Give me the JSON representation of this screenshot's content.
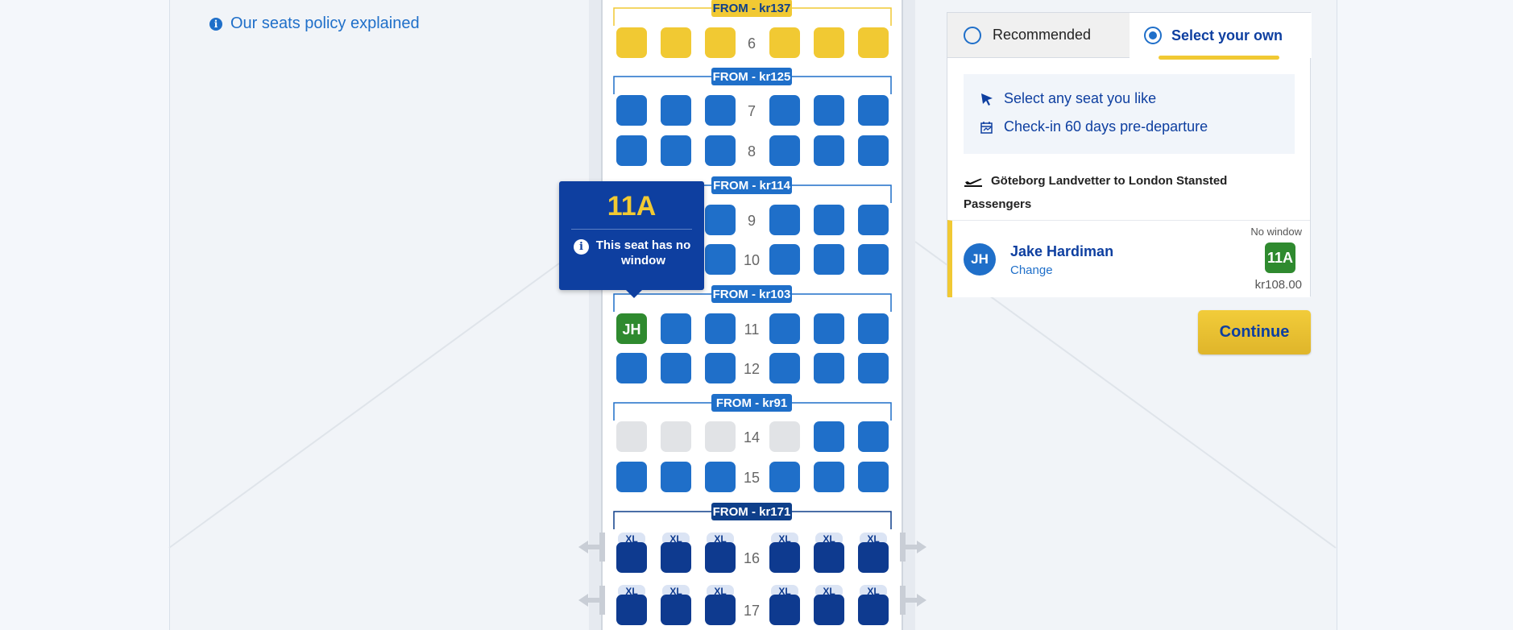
{
  "policy_link": {
    "icon": "info-icon",
    "label": "Our seats policy explained"
  },
  "seat_map": {
    "price_bands": [
      {
        "label": "FROM - kr137",
        "color": "#f1c933",
        "text_color": "#0e3f8a"
      },
      {
        "label": "FROM - kr125",
        "color": "#1f6fc9",
        "text_color": "#ffffff"
      },
      {
        "label": "FROM - kr114",
        "color": "#1f6fc9",
        "text_color": "#ffffff"
      },
      {
        "label": "FROM - kr103",
        "color": "#1f6fc9",
        "text_color": "#ffffff"
      },
      {
        "label": "FROM - kr91",
        "color": "#1f6fc9",
        "text_color": "#ffffff"
      },
      {
        "label": "FROM - kr171",
        "color": "#0e3f8a",
        "text_color": "#ffffff"
      }
    ],
    "rows": [
      {
        "number": "6",
        "type": "yellow",
        "seats": [
          "available",
          "available",
          "available",
          "available",
          "available",
          "available"
        ]
      },
      {
        "number": "7",
        "type": "blue",
        "seats": [
          "available",
          "available",
          "available",
          "available",
          "available",
          "available"
        ]
      },
      {
        "number": "8",
        "type": "blue",
        "seats": [
          "available",
          "available",
          "available",
          "available",
          "available",
          "available"
        ]
      },
      {
        "number": "9",
        "type": "blue",
        "seats": [
          "hidden",
          "hidden",
          "available",
          "available",
          "available",
          "available"
        ]
      },
      {
        "number": "10",
        "type": "blue",
        "seats": [
          "hidden",
          "hidden",
          "available",
          "available",
          "available",
          "available"
        ]
      },
      {
        "number": "11",
        "type": "blue",
        "seats": [
          "selected",
          "available",
          "available",
          "available",
          "available",
          "available"
        ]
      },
      {
        "number": "12",
        "type": "blue",
        "seats": [
          "available",
          "available",
          "available",
          "available",
          "available",
          "available"
        ]
      },
      {
        "number": "14",
        "type": "blue",
        "seats": [
          "unavailable",
          "unavailable",
          "unavailable",
          "unavailable",
          "available",
          "available"
        ]
      },
      {
        "number": "15",
        "type": "blue",
        "seats": [
          "available",
          "available",
          "available",
          "available",
          "available",
          "available"
        ]
      },
      {
        "number": "16",
        "type": "xl",
        "seats": [
          "available",
          "available",
          "available",
          "available",
          "available",
          "available"
        ]
      },
      {
        "number": "17",
        "type": "xl",
        "seats": [
          "available",
          "available",
          "available",
          "available",
          "available",
          "available"
        ]
      }
    ],
    "selected_seat_initials": "JH",
    "xl_label": "XL",
    "colors": {
      "yellow": "#f1c933",
      "blue": "#1f6fc9",
      "navy": "#0e3a8f",
      "unavailable": "#e1e3e6",
      "selected": "#2f8a2f"
    }
  },
  "tooltip": {
    "seat": "11A",
    "icon": "info-icon",
    "message": "This seat has no window"
  },
  "panel": {
    "tabs": [
      {
        "label": "Recommended",
        "selected": false
      },
      {
        "label": "Select your own",
        "selected": true
      }
    ],
    "benefits": [
      {
        "icon": "cursor-icon",
        "text": "Select any seat you like"
      },
      {
        "icon": "calendar-icon",
        "text": "Check-in 60 days pre-departure"
      }
    ],
    "route": {
      "icon": "plane-takeoff-icon",
      "text": "Göteborg Landvetter to London Stansted"
    },
    "passengers_label": "Passengers",
    "passenger": {
      "initials": "JH",
      "name": "Jake Hardiman",
      "change_label": "Change",
      "note": "No window",
      "seat": "11A",
      "price": "kr108.00"
    },
    "continue_label": "Continue"
  }
}
